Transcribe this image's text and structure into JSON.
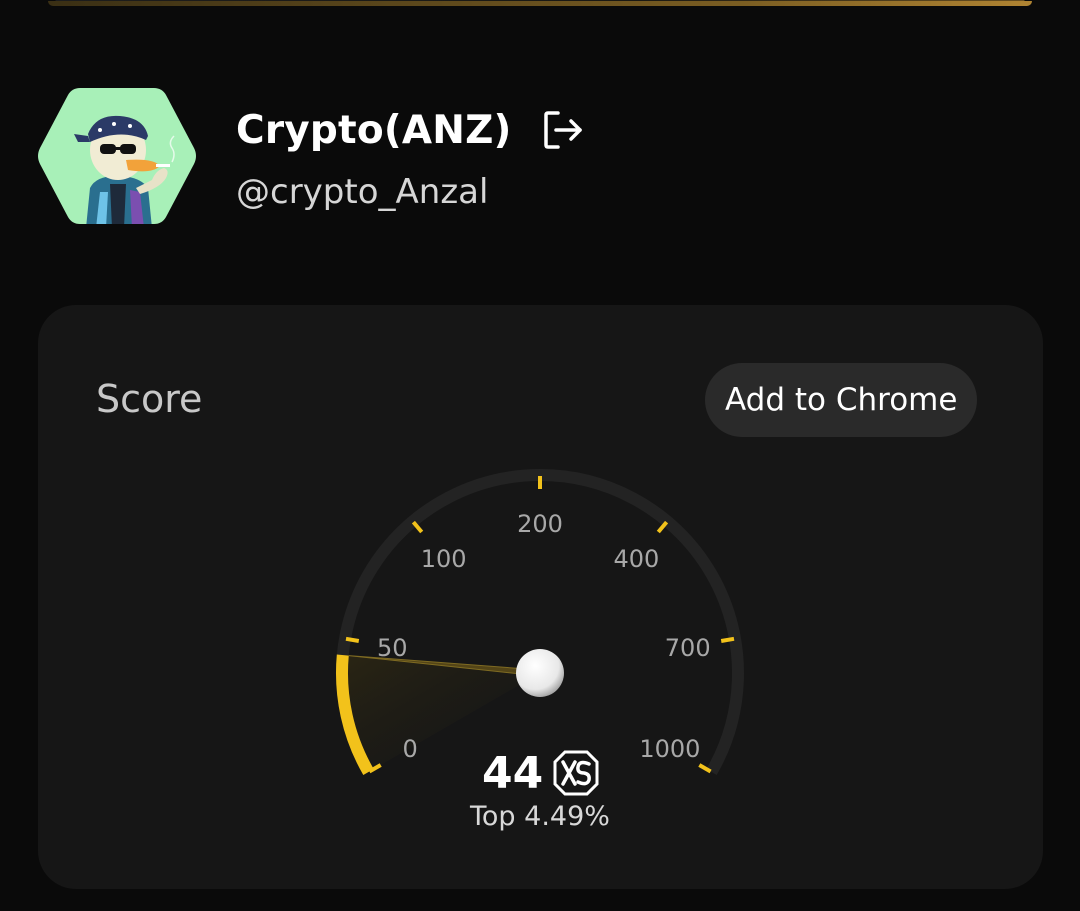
{
  "profile": {
    "name": "Crypto(ANZ)",
    "handle": "@crypto_Anzal",
    "avatar_icon": "duck-avatar-icon",
    "logout_icon": "logout-icon"
  },
  "score_card": {
    "label": "Score",
    "add_button_label": "Add to Chrome",
    "gauge": {
      "tick_labels": [
        "0",
        "50",
        "100",
        "200",
        "400",
        "700",
        "1000"
      ],
      "value": 44,
      "accent_color": "#f2c21b",
      "track_color": "#232323"
    },
    "score_value": "44",
    "badge_icon": "xs-logo-icon",
    "rank_text": "Top 4.49%"
  }
}
